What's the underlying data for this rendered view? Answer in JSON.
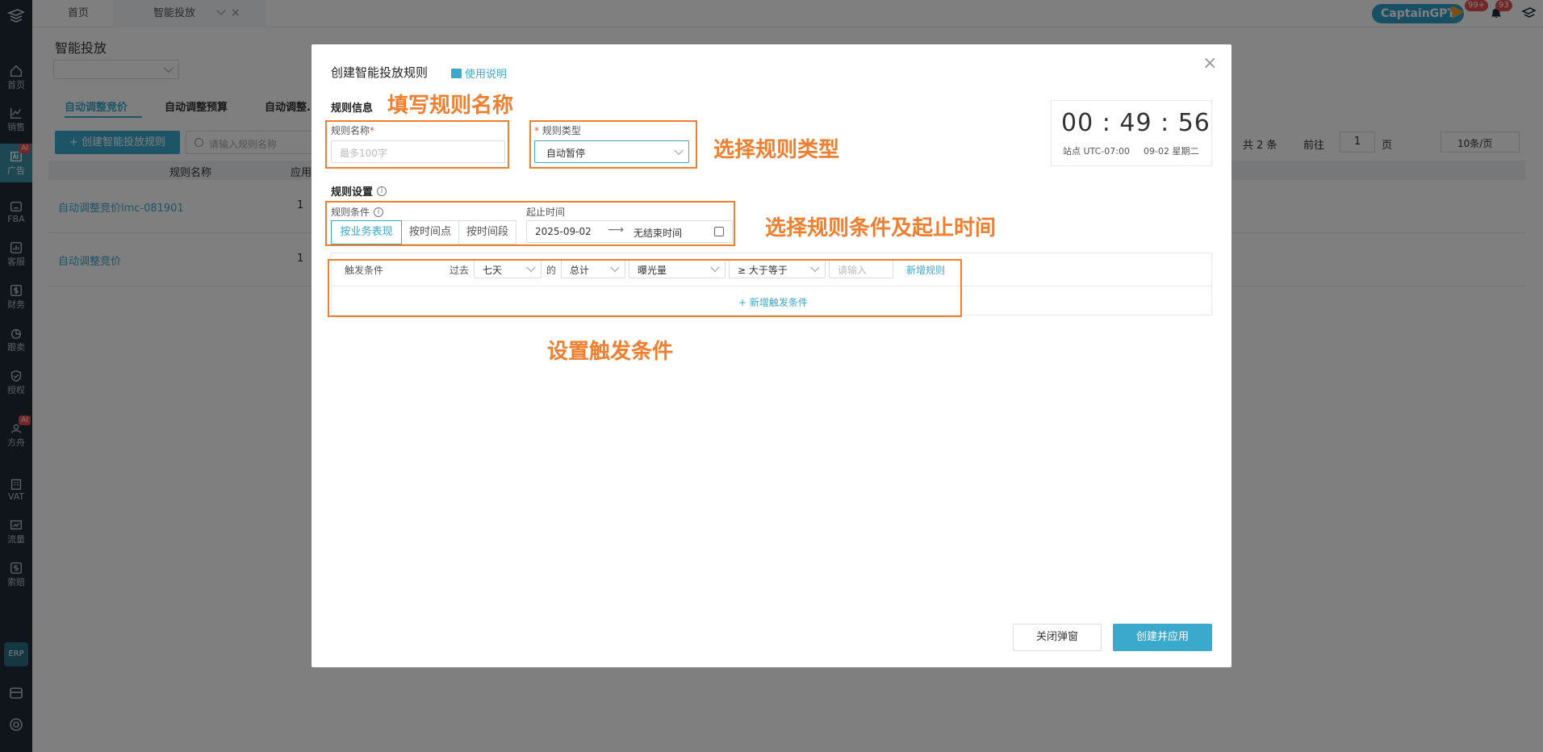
{
  "sidebar": {
    "items": [
      {
        "label": "首页",
        "icon": "home-icon"
      },
      {
        "label": "销售",
        "icon": "chart-line-icon"
      },
      {
        "label": "广告",
        "icon": "ad-icon",
        "badge": "AI"
      },
      {
        "label": "FBA",
        "icon": "box-icon"
      },
      {
        "label": "客服",
        "icon": "service-icon"
      },
      {
        "label": "财务",
        "icon": "dollar-icon"
      },
      {
        "label": "跟卖",
        "icon": "pie-icon"
      },
      {
        "label": "授权",
        "icon": "shield-icon"
      },
      {
        "label": "方舟",
        "icon": "ark-icon",
        "badge": "AI"
      },
      {
        "label": "VAT",
        "icon": "building-icon"
      },
      {
        "label": "流量",
        "icon": "traffic-icon"
      },
      {
        "label": "索赔",
        "icon": "claim-icon"
      }
    ],
    "erp_label": "ERP"
  },
  "topbar": {
    "tabs": [
      "首页",
      "智能投放"
    ],
    "captain_label": "CaptainGPT",
    "badge1": "99+",
    "badge2": "93"
  },
  "page": {
    "title": "智能投放",
    "subtabs": [
      "自动调整竞价",
      "自动调整预算",
      "自动调整..."
    ],
    "create_button": "+ 创建智能投放规则",
    "search_placeholder": "请输入规则名称",
    "table_headers": [
      "规则名称",
      "应用"
    ],
    "rows": [
      {
        "name": "自动调整竞价lmc-081901",
        "count": "1"
      },
      {
        "name": "自动调整竞价",
        "count": "1"
      }
    ],
    "pagination": {
      "total": "共 2 条",
      "goto_label": "前往",
      "page_value": "1",
      "page_suffix": "页",
      "page_size": "10条/页"
    }
  },
  "modal": {
    "title": "创建智能投放规则",
    "help_link": "使用说明",
    "section_info": "规则信息",
    "name_label": "规则名称",
    "name_placeholder": "最多100字",
    "type_label": "规则类型",
    "type_value": "自动暂停",
    "clock": {
      "time": "00 : 49 : 56",
      "site": "站点 UTC-07:00",
      "date": "09-02 星期二"
    },
    "section_settings": "规则设置",
    "condition_label": "规则条件",
    "condition_options": [
      "按业务表现",
      "按时间点",
      "按时间段"
    ],
    "time_label": "起止时间",
    "start_date": "2025-09-02",
    "end_date": "无结束时间",
    "trigger": {
      "label": "触发条件",
      "past_label": "过去",
      "period": "七天",
      "of_label": "的",
      "aggregate": "总计",
      "metric": "曝光量",
      "operator": "≥ 大于等于",
      "value_placeholder": "请输入",
      "add_rule": "新增规则",
      "add_condition": "+ 新增触发条件"
    },
    "close_button": "关闭弹窗",
    "create_button": "创建并应用"
  },
  "annotations": {
    "name": "填写规则名称",
    "type": "选择规则类型",
    "condition": "选择规则条件及起止时间",
    "trigger": "设置触发条件"
  },
  "colors": {
    "accent": "#3aa9cc",
    "annotation": "#ef7f2e",
    "sidebar": "#1f2a37"
  }
}
